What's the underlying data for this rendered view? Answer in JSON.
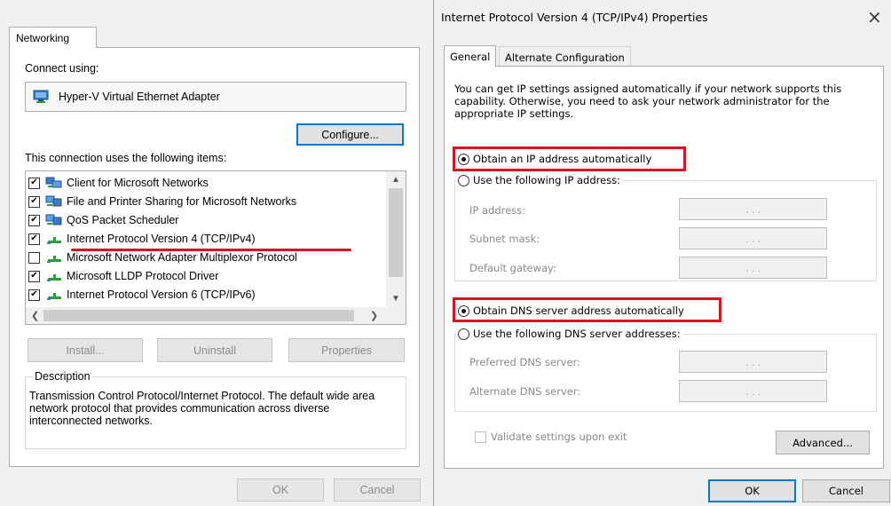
{
  "left": {
    "tab_label": "Networking",
    "connect_using_label": "Connect using:",
    "adapter_name": "Hyper-V Virtual Ethernet Adapter",
    "configure_button": "Configure...",
    "items_label": "This connection uses the following items:",
    "items": [
      {
        "label": "Client for Microsoft Networks",
        "checked": true,
        "icon": "network-client-icon"
      },
      {
        "label": "File and Printer Sharing for Microsoft Networks",
        "checked": true,
        "icon": "network-service-icon"
      },
      {
        "label": "QoS Packet Scheduler",
        "checked": true,
        "icon": "network-service-icon"
      },
      {
        "label": "Internet Protocol Version 4 (TCP/IPv4)",
        "checked": true,
        "icon": "protocol-icon"
      },
      {
        "label": "Microsoft Network Adapter Multiplexor Protocol",
        "checked": false,
        "icon": "protocol-icon"
      },
      {
        "label": "Microsoft LLDP Protocol Driver",
        "checked": true,
        "icon": "protocol-icon"
      },
      {
        "label": "Internet Protocol Version 6 (TCP/IPv6)",
        "checked": true,
        "icon": "protocol-icon"
      }
    ],
    "install_button": "Install...",
    "uninstall_button": "Uninstall",
    "properties_button": "Properties",
    "description_label": "Description",
    "description_text": "Transmission Control Protocol/Internet Protocol. The default wide area network protocol that provides communication across diverse interconnected networks.",
    "ok_button": "OK",
    "cancel_button": "Cancel"
  },
  "right": {
    "title": "Internet Protocol Version 4 (TCP/IPv4) Properties",
    "close_glyph": "×",
    "tabs": [
      {
        "label": "General",
        "active": true
      },
      {
        "label": "Alternate Configuration",
        "active": false
      }
    ],
    "intro_text": "You can get IP settings assigned automatically if your network supports this capability. Otherwise, you need to ask your network administrator for the appropriate IP settings.",
    "obtain_ip_auto": "Obtain an IP address automatically",
    "use_following_ip": "Use the following IP address:",
    "ip_address_label": "IP address:",
    "subnet_mask_label": "Subnet mask:",
    "default_gateway_label": "Default gateway:",
    "ip_dots": ".       .       .",
    "obtain_dns_auto": "Obtain DNS server address automatically",
    "use_following_dns": "Use the following DNS server addresses:",
    "preferred_dns_label": "Preferred DNS server:",
    "alternate_dns_label": "Alternate DNS server:",
    "validate_label": "Validate settings upon exit",
    "advanced_button": "Advanced...",
    "ok_button": "OK",
    "cancel_button": "Cancel"
  },
  "colors": {
    "highlight_red": "#e0101e",
    "focus_blue": "#0078d7",
    "underline_red": "#d4161f"
  }
}
